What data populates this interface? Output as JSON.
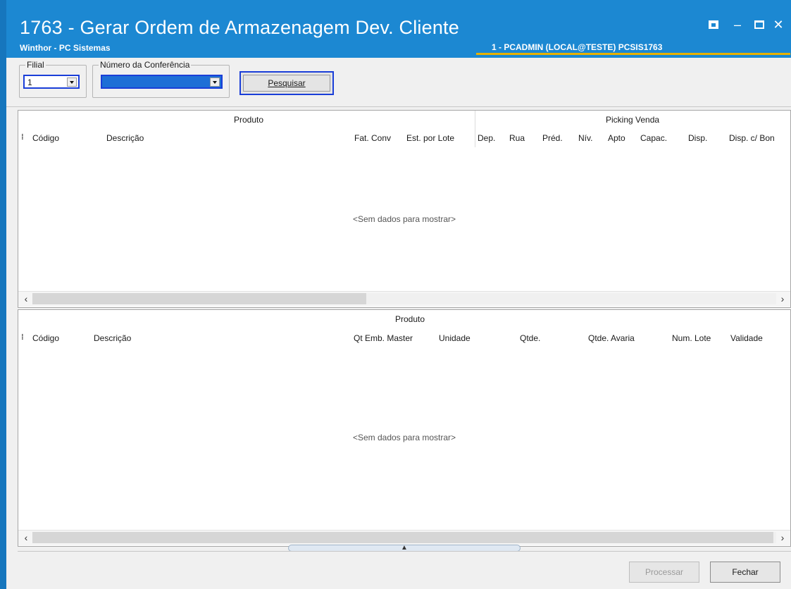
{
  "window": {
    "title": "1763 - Gerar Ordem de Armazenagem Dev. Cliente",
    "subtitle": "Winthor - PC Sistemas",
    "user_info": "1 - PCADMIN (LOCAL@TESTE)  PCSIS1763",
    "controls": [
      "restore-icon",
      "minimize-icon",
      "maximize-icon",
      "close-icon"
    ],
    "accent_color": "#1c88d2",
    "underline_color": "#e7b100"
  },
  "filters": {
    "filial_label": "Filial",
    "filial_value": "1",
    "conferencia_label": "Número da Conferência",
    "conferencia_value": "",
    "search_button": "Pesquisar"
  },
  "grid_top": {
    "band_produto": "Produto",
    "band_picking": "Picking Venda",
    "columns": [
      "Código",
      "Descrição",
      "Fat. Conv",
      "Est. por Lote",
      "Dep.",
      "Rua",
      "Préd.",
      "Nív.",
      "Apto",
      "Capac.",
      "Disp.",
      "Disp. c/ Bon"
    ],
    "empty_text": "<Sem dados para mostrar>"
  },
  "grid_bottom": {
    "band_produto": "Produto",
    "columns": [
      "Código",
      "Descrição",
      "Qt Emb. Master",
      "Unidade",
      "Qtde.",
      "Qtde. Avaria",
      "Num. Lote",
      "Validade"
    ],
    "empty_text": "<Sem dados para mostrar>"
  },
  "actions": {
    "processar": "Processar",
    "fechar": "Fechar"
  }
}
